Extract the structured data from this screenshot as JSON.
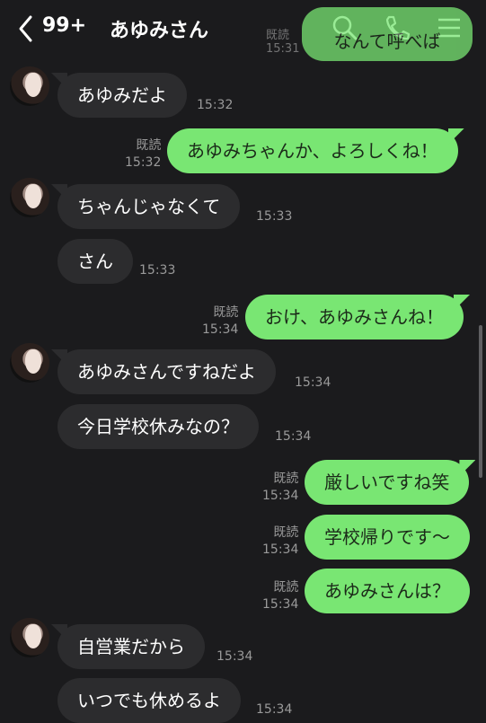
{
  "header": {
    "unread_count": "99+",
    "title": "あゆみさん"
  },
  "messages": [
    {
      "text": "なんて呼べば",
      "read": "既読",
      "time": "15:31"
    },
    {
      "text": "あゆみだよ",
      "time": "15:32"
    },
    {
      "text": "あゆみちゃんか、よろしくね！",
      "read": "既読",
      "time": "15:32"
    },
    {
      "text": "ちゃんじゃなくて",
      "time": "15:33"
    },
    {
      "text": "さん",
      "time": "15:33"
    },
    {
      "text": "おけ、あゆみさんね！",
      "read": "既読",
      "time": "15:34"
    },
    {
      "text": "あゆみさんですねだよ",
      "time": "15:34"
    },
    {
      "text": "今日学校休みなの？",
      "time": "15:34"
    },
    {
      "text": "厳しいですね笑",
      "read": "既読",
      "time": "15:34"
    },
    {
      "text": "学校帰りです～",
      "read": "既読",
      "time": "15:34"
    },
    {
      "text": "あゆみさんは？",
      "read": "既読",
      "time": "15:34"
    },
    {
      "text": "自営業だから",
      "time": "15:34"
    },
    {
      "text": "いつでも休めるよ",
      "time": "15:34"
    }
  ],
  "colors": {
    "background": "#1b1b1d",
    "incoming_bubble": "#2c2c2e",
    "outgoing_bubble": "#79e673"
  },
  "icons": [
    "back-arrow-icon",
    "search-icon",
    "phone-icon",
    "menu-icon"
  ]
}
